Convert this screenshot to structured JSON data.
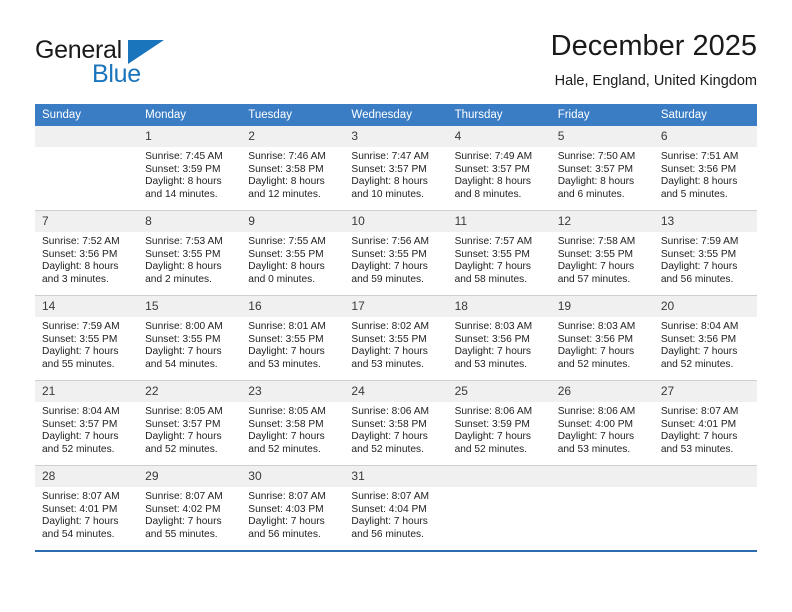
{
  "brand": {
    "name_part1": "General",
    "name_part2": "Blue",
    "logo_icon": "blue-triangle-logo"
  },
  "header": {
    "month_title": "December 2025",
    "location": "Hale, England, United Kingdom"
  },
  "colors": {
    "header_blue": "#3b7dc4",
    "brand_blue": "#1b75bc",
    "daynum_band": "#f0f0f0",
    "row_divider": "#cfcfcf",
    "bottom_border": "#2b6cb0"
  },
  "calendar": {
    "weekday_headers": [
      "Sunday",
      "Monday",
      "Tuesday",
      "Wednesday",
      "Thursday",
      "Friday",
      "Saturday"
    ],
    "weeks": [
      [
        {
          "day": "",
          "lines": []
        },
        {
          "day": "1",
          "lines": [
            "Sunrise: 7:45 AM",
            "Sunset: 3:59 PM",
            "Daylight: 8 hours",
            "and 14 minutes."
          ]
        },
        {
          "day": "2",
          "lines": [
            "Sunrise: 7:46 AM",
            "Sunset: 3:58 PM",
            "Daylight: 8 hours",
            "and 12 minutes."
          ]
        },
        {
          "day": "3",
          "lines": [
            "Sunrise: 7:47 AM",
            "Sunset: 3:57 PM",
            "Daylight: 8 hours",
            "and 10 minutes."
          ]
        },
        {
          "day": "4",
          "lines": [
            "Sunrise: 7:49 AM",
            "Sunset: 3:57 PM",
            "Daylight: 8 hours",
            "and 8 minutes."
          ]
        },
        {
          "day": "5",
          "lines": [
            "Sunrise: 7:50 AM",
            "Sunset: 3:57 PM",
            "Daylight: 8 hours",
            "and 6 minutes."
          ]
        },
        {
          "day": "6",
          "lines": [
            "Sunrise: 7:51 AM",
            "Sunset: 3:56 PM",
            "Daylight: 8 hours",
            "and 5 minutes."
          ]
        }
      ],
      [
        {
          "day": "7",
          "lines": [
            "Sunrise: 7:52 AM",
            "Sunset: 3:56 PM",
            "Daylight: 8 hours",
            "and 3 minutes."
          ]
        },
        {
          "day": "8",
          "lines": [
            "Sunrise: 7:53 AM",
            "Sunset: 3:55 PM",
            "Daylight: 8 hours",
            "and 2 minutes."
          ]
        },
        {
          "day": "9",
          "lines": [
            "Sunrise: 7:55 AM",
            "Sunset: 3:55 PM",
            "Daylight: 8 hours",
            "and 0 minutes."
          ]
        },
        {
          "day": "10",
          "lines": [
            "Sunrise: 7:56 AM",
            "Sunset: 3:55 PM",
            "Daylight: 7 hours",
            "and 59 minutes."
          ]
        },
        {
          "day": "11",
          "lines": [
            "Sunrise: 7:57 AM",
            "Sunset: 3:55 PM",
            "Daylight: 7 hours",
            "and 58 minutes."
          ]
        },
        {
          "day": "12",
          "lines": [
            "Sunrise: 7:58 AM",
            "Sunset: 3:55 PM",
            "Daylight: 7 hours",
            "and 57 minutes."
          ]
        },
        {
          "day": "13",
          "lines": [
            "Sunrise: 7:59 AM",
            "Sunset: 3:55 PM",
            "Daylight: 7 hours",
            "and 56 minutes."
          ]
        }
      ],
      [
        {
          "day": "14",
          "lines": [
            "Sunrise: 7:59 AM",
            "Sunset: 3:55 PM",
            "Daylight: 7 hours",
            "and 55 minutes."
          ]
        },
        {
          "day": "15",
          "lines": [
            "Sunrise: 8:00 AM",
            "Sunset: 3:55 PM",
            "Daylight: 7 hours",
            "and 54 minutes."
          ]
        },
        {
          "day": "16",
          "lines": [
            "Sunrise: 8:01 AM",
            "Sunset: 3:55 PM",
            "Daylight: 7 hours",
            "and 53 minutes."
          ]
        },
        {
          "day": "17",
          "lines": [
            "Sunrise: 8:02 AM",
            "Sunset: 3:55 PM",
            "Daylight: 7 hours",
            "and 53 minutes."
          ]
        },
        {
          "day": "18",
          "lines": [
            "Sunrise: 8:03 AM",
            "Sunset: 3:56 PM",
            "Daylight: 7 hours",
            "and 53 minutes."
          ]
        },
        {
          "day": "19",
          "lines": [
            "Sunrise: 8:03 AM",
            "Sunset: 3:56 PM",
            "Daylight: 7 hours",
            "and 52 minutes."
          ]
        },
        {
          "day": "20",
          "lines": [
            "Sunrise: 8:04 AM",
            "Sunset: 3:56 PM",
            "Daylight: 7 hours",
            "and 52 minutes."
          ]
        }
      ],
      [
        {
          "day": "21",
          "lines": [
            "Sunrise: 8:04 AM",
            "Sunset: 3:57 PM",
            "Daylight: 7 hours",
            "and 52 minutes."
          ]
        },
        {
          "day": "22",
          "lines": [
            "Sunrise: 8:05 AM",
            "Sunset: 3:57 PM",
            "Daylight: 7 hours",
            "and 52 minutes."
          ]
        },
        {
          "day": "23",
          "lines": [
            "Sunrise: 8:05 AM",
            "Sunset: 3:58 PM",
            "Daylight: 7 hours",
            "and 52 minutes."
          ]
        },
        {
          "day": "24",
          "lines": [
            "Sunrise: 8:06 AM",
            "Sunset: 3:58 PM",
            "Daylight: 7 hours",
            "and 52 minutes."
          ]
        },
        {
          "day": "25",
          "lines": [
            "Sunrise: 8:06 AM",
            "Sunset: 3:59 PM",
            "Daylight: 7 hours",
            "and 52 minutes."
          ]
        },
        {
          "day": "26",
          "lines": [
            "Sunrise: 8:06 AM",
            "Sunset: 4:00 PM",
            "Daylight: 7 hours",
            "and 53 minutes."
          ]
        },
        {
          "day": "27",
          "lines": [
            "Sunrise: 8:07 AM",
            "Sunset: 4:01 PM",
            "Daylight: 7 hours",
            "and 53 minutes."
          ]
        }
      ],
      [
        {
          "day": "28",
          "lines": [
            "Sunrise: 8:07 AM",
            "Sunset: 4:01 PM",
            "Daylight: 7 hours",
            "and 54 minutes."
          ]
        },
        {
          "day": "29",
          "lines": [
            "Sunrise: 8:07 AM",
            "Sunset: 4:02 PM",
            "Daylight: 7 hours",
            "and 55 minutes."
          ]
        },
        {
          "day": "30",
          "lines": [
            "Sunrise: 8:07 AM",
            "Sunset: 4:03 PM",
            "Daylight: 7 hours",
            "and 56 minutes."
          ]
        },
        {
          "day": "31",
          "lines": [
            "Sunrise: 8:07 AM",
            "Sunset: 4:04 PM",
            "Daylight: 7 hours",
            "and 56 minutes."
          ]
        },
        {
          "day": "",
          "lines": []
        },
        {
          "day": "",
          "lines": []
        },
        {
          "day": "",
          "lines": []
        }
      ]
    ]
  }
}
